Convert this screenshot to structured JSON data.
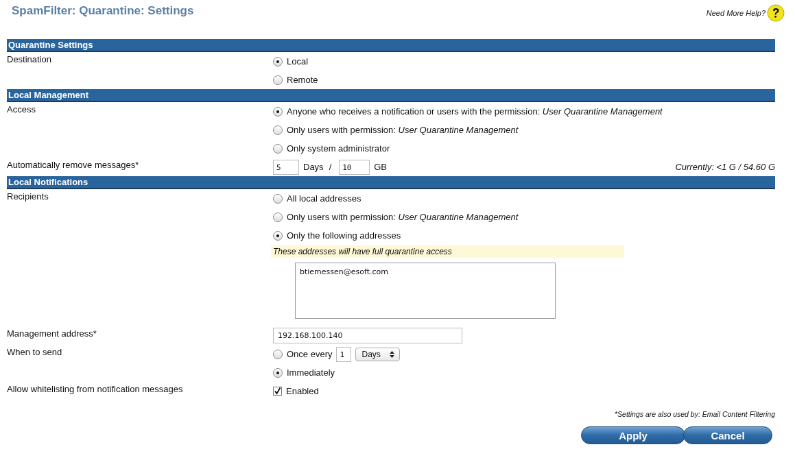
{
  "page": {
    "title": "SpamFilter: Quarantine: Settings",
    "help_text": "Need More Help?"
  },
  "sections": [
    {
      "title": "Quarantine Settings",
      "rows": [
        {
          "label": "Destination",
          "lines": [
            {
              "kind": "radio",
              "text": "Local",
              "selected": true
            },
            {
              "kind": "radio",
              "text": "Remote",
              "selected": false
            }
          ]
        }
      ]
    },
    {
      "title": "Local Management",
      "rows": [
        {
          "label": "Access",
          "lines": [
            {
              "kind": "radio",
              "text": "Anyone who receives a notification or users with the permission: *User Quarantine Management*",
              "selected": true
            },
            {
              "kind": "radio",
              "text": "Only users with permission: *User Quarantine Management*",
              "selected": false
            },
            {
              "kind": "radio",
              "text": "Only system administrator",
              "selected": false
            }
          ]
        },
        {
          "label": "Automatically remove messages*",
          "lines": [
            {
              "kind": "limits",
              "days_value": "5",
              "days_unit": "Days",
              "separator": "/",
              "size_value": "10",
              "size_unit": "GB",
              "status": "Currently: <1 G / 54.60 G"
            }
          ]
        }
      ]
    },
    {
      "title": "Local Notifications",
      "rows": [
        {
          "label": "Recipients",
          "lines": [
            {
              "kind": "radio",
              "text": "All local addresses",
              "selected": false
            },
            {
              "kind": "radio",
              "text": "Only users with permission: *User Quarantine Management*",
              "selected": false
            },
            {
              "kind": "radio",
              "text": "Only the following addresses",
              "selected": true
            },
            {
              "kind": "note",
              "text": "These addresses will have full quarantine access"
            },
            {
              "kind": "textarea",
              "value": "btiemessen@esoft.com"
            }
          ]
        },
        {
          "label": "Management address*",
          "lines": [
            {
              "kind": "text",
              "value": "192.168.100.140"
            }
          ]
        },
        {
          "label": "When to send",
          "lines": [
            {
              "kind": "interval",
              "text": "Once every",
              "value": "1",
              "unit": "Days",
              "selected": false
            },
            {
              "kind": "radio",
              "text": "Immediately",
              "selected": true
            }
          ]
        },
        {
          "label": "Allow whitelisting from notification messages",
          "lines": [
            {
              "kind": "checkbox",
              "text": "Enabled",
              "checked": true
            }
          ]
        }
      ]
    }
  ],
  "footnote": "*Settings are also used by: Email Content Filtering",
  "buttons": [
    "Apply",
    "Cancel"
  ]
}
